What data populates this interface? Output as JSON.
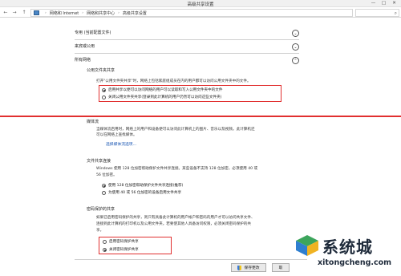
{
  "window": {
    "title": "高级共享设置",
    "controls": {
      "minimize": "—",
      "maximize": "□",
      "close": "✕"
    }
  },
  "address": {
    "back": "←",
    "forward": "→",
    "up": "↑",
    "crumbs": [
      "网络和 Internet",
      "网络和共享中心",
      "高级共享设置"
    ],
    "search_icon": "⌕"
  },
  "sections": {
    "private": {
      "label": "专用 (当前配置文件)",
      "chevron": "⌄"
    },
    "guest": {
      "label": "来宾或公用",
      "chevron": "⌄"
    },
    "all": {
      "label": "所有网络",
      "chevron": "⌃"
    }
  },
  "public_folder": {
    "title": "公用文件夹共享",
    "desc": "打开\"公用文件夹共享\"时，网络上包括家庭组成员在内的用户都可以访问公用文件夹中的文件。",
    "options": [
      {
        "label": "启用共享以便可以访问网络的用户可以读取和写入公用文件夹中的文件",
        "selected": true
      },
      {
        "label": "关闭公用文件夹共享(登录到此计算机的用户仍然可以访问这些文件夹)",
        "selected": false
      }
    ]
  },
  "media": {
    "title": "媒体流",
    "desc1": "当媒体流启用时，网络上的用户和设备便可以访问此计算机上的图片、音乐以及视频。此计算机还",
    "desc2": "可以在网络上查找媒体。",
    "link": "选择媒体流选项..."
  },
  "file_sharing": {
    "title": "文件共享连接",
    "desc1": "Windows 使用 128 位加密帮助保护文件共享连接。某些设备不支持 128 位加密，必须使用 40 或",
    "desc2": "56 位加密。",
    "options": [
      {
        "label": "使用 128 位加密帮助保护文件共享连接(推荐)",
        "selected": true
      },
      {
        "label": "为使用 40 或 56 位加密的设备启用文件共享",
        "selected": false
      }
    ]
  },
  "password": {
    "title": "密码保护的共享",
    "desc1": "如果已启用密码保护的共享，则只有具备此计算机的用户帐户和密码的用户才可以访问共享文件、",
    "desc2": "连接到此计算机的打印机以及公用文件夹。若要使其他人具备访问权限，必须关闭密码保护的共",
    "desc3": "享。",
    "options": [
      {
        "label": "启用密码保护共享",
        "selected": false
      },
      {
        "label": "关闭密码保护共享",
        "selected": true
      }
    ]
  },
  "footer": {
    "save": "保存更改",
    "cancel": "取"
  },
  "watermark": {
    "brand": "系统城",
    "url": "xitongcheng.com"
  },
  "colors": {
    "highlight": "#e13030",
    "link": "#1a56b3"
  }
}
